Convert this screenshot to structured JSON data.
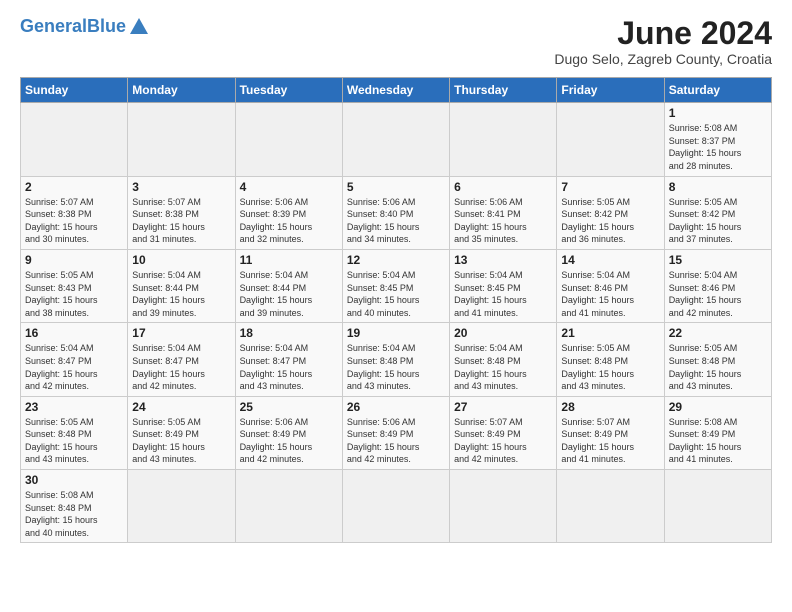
{
  "header": {
    "logo_general": "General",
    "logo_blue": "Blue",
    "month_title": "June 2024",
    "location": "Dugo Selo, Zagreb County, Croatia"
  },
  "days_of_week": [
    "Sunday",
    "Monday",
    "Tuesday",
    "Wednesday",
    "Thursday",
    "Friday",
    "Saturday"
  ],
  "weeks": [
    [
      {
        "day": "",
        "info": ""
      },
      {
        "day": "",
        "info": ""
      },
      {
        "day": "",
        "info": ""
      },
      {
        "day": "",
        "info": ""
      },
      {
        "day": "",
        "info": ""
      },
      {
        "day": "",
        "info": ""
      },
      {
        "day": "1",
        "info": "Sunrise: 5:08 AM\nSunset: 8:37 PM\nDaylight: 15 hours\nand 28 minutes."
      }
    ],
    [
      {
        "day": "2",
        "info": "Sunrise: 5:07 AM\nSunset: 8:38 PM\nDaylight: 15 hours\nand 30 minutes."
      },
      {
        "day": "3",
        "info": "Sunrise: 5:07 AM\nSunset: 8:38 PM\nDaylight: 15 hours\nand 31 minutes."
      },
      {
        "day": "4",
        "info": "Sunrise: 5:06 AM\nSunset: 8:39 PM\nDaylight: 15 hours\nand 32 minutes."
      },
      {
        "day": "5",
        "info": "Sunrise: 5:06 AM\nSunset: 8:40 PM\nDaylight: 15 hours\nand 34 minutes."
      },
      {
        "day": "6",
        "info": "Sunrise: 5:06 AM\nSunset: 8:41 PM\nDaylight: 15 hours\nand 35 minutes."
      },
      {
        "day": "7",
        "info": "Sunrise: 5:05 AM\nSunset: 8:42 PM\nDaylight: 15 hours\nand 36 minutes."
      },
      {
        "day": "8",
        "info": "Sunrise: 5:05 AM\nSunset: 8:42 PM\nDaylight: 15 hours\nand 37 minutes."
      }
    ],
    [
      {
        "day": "9",
        "info": "Sunrise: 5:05 AM\nSunset: 8:43 PM\nDaylight: 15 hours\nand 38 minutes."
      },
      {
        "day": "10",
        "info": "Sunrise: 5:04 AM\nSunset: 8:44 PM\nDaylight: 15 hours\nand 39 minutes."
      },
      {
        "day": "11",
        "info": "Sunrise: 5:04 AM\nSunset: 8:44 PM\nDaylight: 15 hours\nand 39 minutes."
      },
      {
        "day": "12",
        "info": "Sunrise: 5:04 AM\nSunset: 8:45 PM\nDaylight: 15 hours\nand 40 minutes."
      },
      {
        "day": "13",
        "info": "Sunrise: 5:04 AM\nSunset: 8:45 PM\nDaylight: 15 hours\nand 41 minutes."
      },
      {
        "day": "14",
        "info": "Sunrise: 5:04 AM\nSunset: 8:46 PM\nDaylight: 15 hours\nand 41 minutes."
      },
      {
        "day": "15",
        "info": "Sunrise: 5:04 AM\nSunset: 8:46 PM\nDaylight: 15 hours\nand 42 minutes."
      }
    ],
    [
      {
        "day": "16",
        "info": "Sunrise: 5:04 AM\nSunset: 8:47 PM\nDaylight: 15 hours\nand 42 minutes."
      },
      {
        "day": "17",
        "info": "Sunrise: 5:04 AM\nSunset: 8:47 PM\nDaylight: 15 hours\nand 42 minutes."
      },
      {
        "day": "18",
        "info": "Sunrise: 5:04 AM\nSunset: 8:47 PM\nDaylight: 15 hours\nand 43 minutes."
      },
      {
        "day": "19",
        "info": "Sunrise: 5:04 AM\nSunset: 8:48 PM\nDaylight: 15 hours\nand 43 minutes."
      },
      {
        "day": "20",
        "info": "Sunrise: 5:04 AM\nSunset: 8:48 PM\nDaylight: 15 hours\nand 43 minutes."
      },
      {
        "day": "21",
        "info": "Sunrise: 5:05 AM\nSunset: 8:48 PM\nDaylight: 15 hours\nand 43 minutes."
      },
      {
        "day": "22",
        "info": "Sunrise: 5:05 AM\nSunset: 8:48 PM\nDaylight: 15 hours\nand 43 minutes."
      }
    ],
    [
      {
        "day": "23",
        "info": "Sunrise: 5:05 AM\nSunset: 8:48 PM\nDaylight: 15 hours\nand 43 minutes."
      },
      {
        "day": "24",
        "info": "Sunrise: 5:05 AM\nSunset: 8:49 PM\nDaylight: 15 hours\nand 43 minutes."
      },
      {
        "day": "25",
        "info": "Sunrise: 5:06 AM\nSunset: 8:49 PM\nDaylight: 15 hours\nand 42 minutes."
      },
      {
        "day": "26",
        "info": "Sunrise: 5:06 AM\nSunset: 8:49 PM\nDaylight: 15 hours\nand 42 minutes."
      },
      {
        "day": "27",
        "info": "Sunrise: 5:07 AM\nSunset: 8:49 PM\nDaylight: 15 hours\nand 42 minutes."
      },
      {
        "day": "28",
        "info": "Sunrise: 5:07 AM\nSunset: 8:49 PM\nDaylight: 15 hours\nand 41 minutes."
      },
      {
        "day": "29",
        "info": "Sunrise: 5:08 AM\nSunset: 8:49 PM\nDaylight: 15 hours\nand 41 minutes."
      }
    ],
    [
      {
        "day": "30",
        "info": "Sunrise: 5:08 AM\nSunset: 8:48 PM\nDaylight: 15 hours\nand 40 minutes."
      },
      {
        "day": "",
        "info": ""
      },
      {
        "day": "",
        "info": ""
      },
      {
        "day": "",
        "info": ""
      },
      {
        "day": "",
        "info": ""
      },
      {
        "day": "",
        "info": ""
      },
      {
        "day": "",
        "info": ""
      }
    ]
  ]
}
